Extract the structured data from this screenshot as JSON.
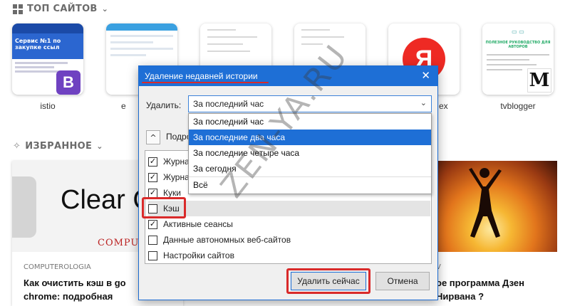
{
  "top_sites": {
    "heading": "ТОП САЙТОВ",
    "tiles": [
      {
        "label": "istio",
        "thumb_text": "Сервис №1 по закупке ссыл",
        "badge": "B"
      },
      {
        "label": "e",
        "thumb_text": ""
      },
      {
        "label": "",
        "thumb_text": ""
      },
      {
        "label": "",
        "thumb_text": ""
      },
      {
        "label": "ex",
        "thumb_text": "",
        "badge": "Я"
      },
      {
        "label": "tvblogger",
        "thumb_text": "ПОЛЕЗНОЕ РУКОВОДСТВО ДЛЯ АВТОРОВ",
        "badge": "M"
      }
    ]
  },
  "favorites": {
    "heading": "ИЗБРАННОЕ",
    "cards": [
      {
        "image_text": "Clear C",
        "image_subtext": "COMPUTER",
        "source": "COMPUTEROLOGIA",
        "title": "Как очистить кэш в go chrome: подробная"
      },
      {
        "source": "V",
        "title": "ое программа Дзен Нирвана ?"
      }
    ]
  },
  "dialog": {
    "title": "Удаление недавней истории",
    "close_glyph": "✕",
    "delete_label": "Удалить:",
    "selected_value": "За последний час",
    "select_arrow": "⌄",
    "dropdown_options": [
      {
        "label": "За последний час",
        "highlighted": false
      },
      {
        "label": "За последние два часа",
        "highlighted": true
      },
      {
        "label": "За последние четыре часа",
        "highlighted": false
      },
      {
        "label": "За сегодня",
        "highlighted": false
      },
      {
        "label": "Всё",
        "highlighted": false
      }
    ],
    "details_expand_glyph": "^",
    "details_label": "Подро",
    "checkboxes": [
      {
        "label": "Журна",
        "checked": true
      },
      {
        "label": "Журна",
        "checked": true
      },
      {
        "label": "Куки",
        "checked": true
      },
      {
        "label": "Кэш",
        "checked": false
      },
      {
        "label": "Активные сеансы",
        "checked": true
      },
      {
        "label": "Данные автономных веб-сайтов",
        "checked": false
      },
      {
        "label": "Настройки сайтов",
        "checked": false
      }
    ],
    "delete_now_button": "Удалить сейчас",
    "cancel_button": "Отмена",
    "highlight_color": "#d92a2a"
  },
  "watermark": "ZEN-YA.RU",
  "colors": {
    "title_bar": "#1e6fd6",
    "selected_option": "#1e6fd6",
    "annotation_red": "#d92a2a"
  }
}
